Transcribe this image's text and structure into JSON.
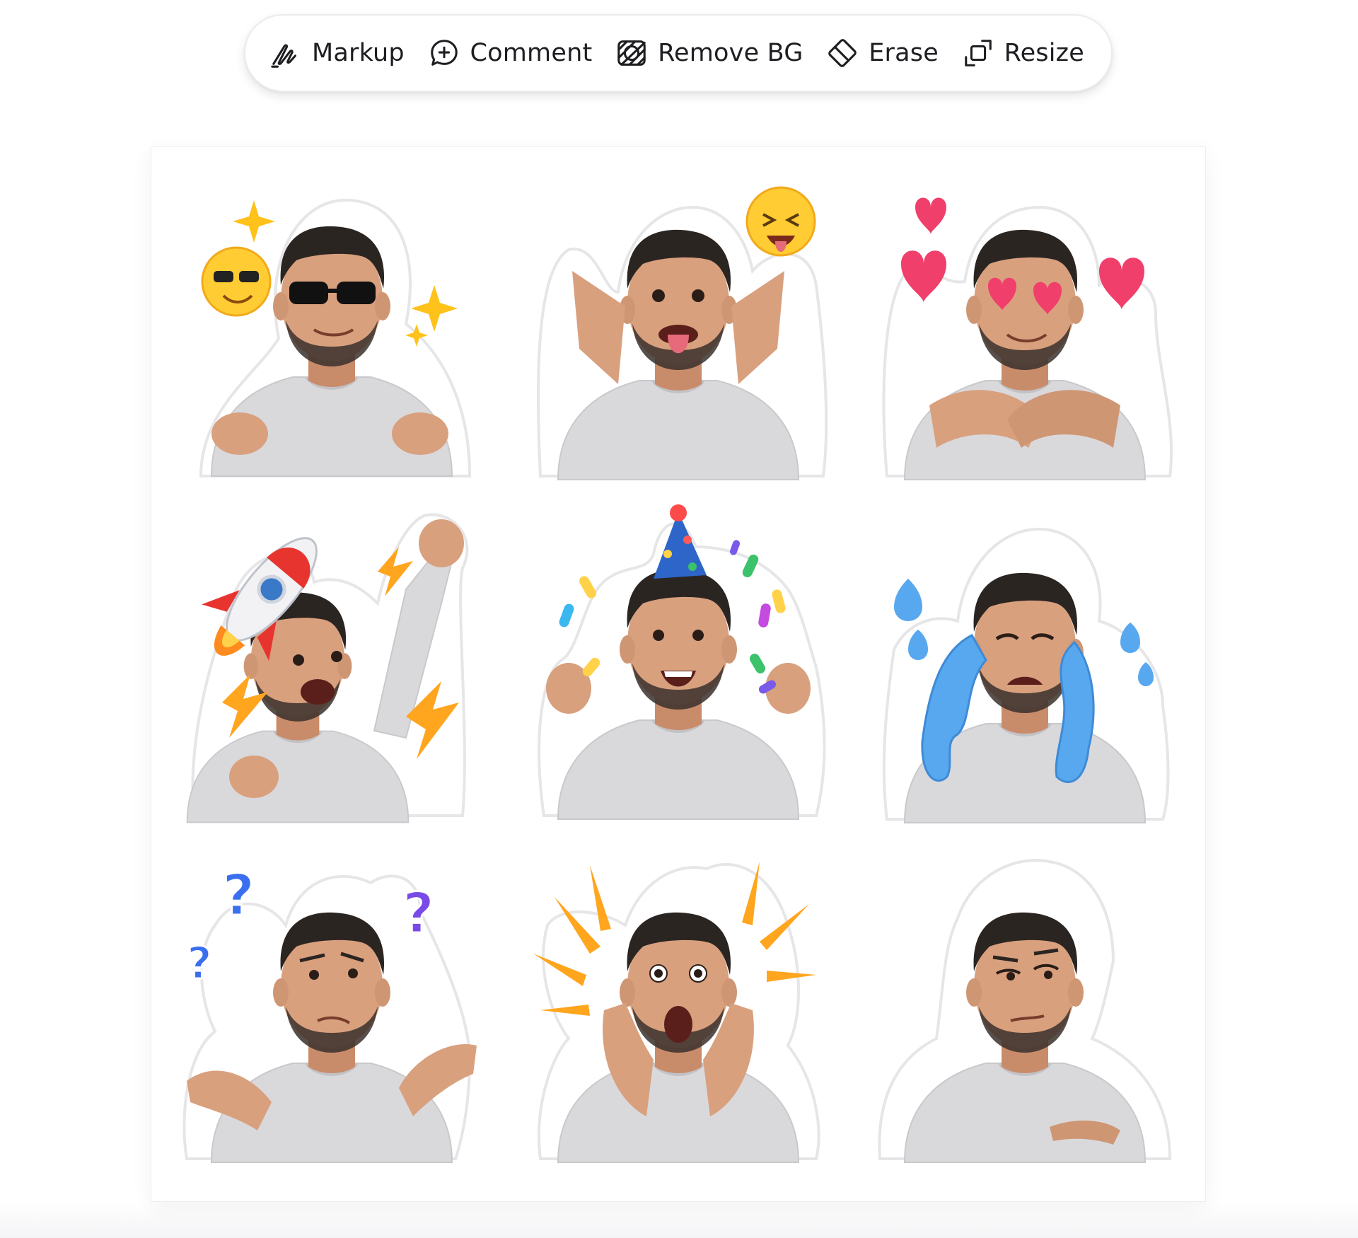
{
  "toolbar": {
    "items": [
      {
        "label": "Markup",
        "icon": "markup-icon"
      },
      {
        "label": "Comment",
        "icon": "comment-add-icon"
      },
      {
        "label": "Remove BG",
        "icon": "remove-bg-icon"
      },
      {
        "label": "Erase",
        "icon": "eraser-icon"
      },
      {
        "label": "Resize",
        "icon": "resize-icon"
      }
    ]
  },
  "sheet": {
    "stickers": [
      {
        "expression": "cool",
        "props": [
          "sunglasses",
          "smiling-face-with-sunglasses-emoji",
          "sparkles",
          "finger-guns"
        ]
      },
      {
        "expression": "silly",
        "props": [
          "tongue-out",
          "winking-face-with-tongue-emoji",
          "open-hands"
        ]
      },
      {
        "expression": "love",
        "props": [
          "heart-eyes",
          "hearts",
          "self-hug"
        ]
      },
      {
        "expression": "excited",
        "props": [
          "rocket-emoji",
          "lightning-bolts",
          "raised-fist"
        ]
      },
      {
        "expression": "celebrate",
        "props": [
          "party-hat",
          "confetti",
          "fists-up"
        ]
      },
      {
        "expression": "crying",
        "props": [
          "blue-tears",
          "tear-drops"
        ]
      },
      {
        "expression": "confused",
        "props": [
          "question-marks",
          "shrug"
        ]
      },
      {
        "expression": "shocked",
        "props": [
          "burst-lines",
          "hands-on-cheeks"
        ]
      },
      {
        "expression": "skeptical",
        "props": [
          "arms-crossed"
        ]
      }
    ]
  },
  "colors": {
    "toolbar_text": "#1e1e22",
    "sweater": "#d9d9dc",
    "skin": "#d9a07e",
    "hair": "#2b2522",
    "sticker_outline": "#e6e6e8"
  }
}
